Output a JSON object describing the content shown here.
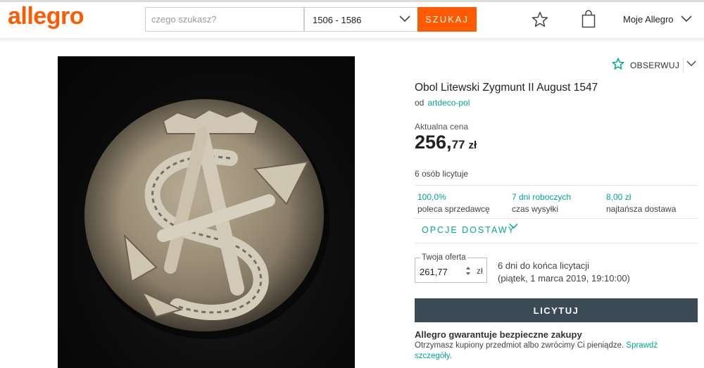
{
  "header": {
    "logo": "allegro",
    "search_placeholder": "czego szukasz?",
    "category_value": "1506 - 1586",
    "search_button": "SZUKAJ",
    "account_label": "Moje Allegro"
  },
  "listing": {
    "watch_label": "OBSERWUJ",
    "title": "Obol Litewski Zygmunt II August 1547",
    "seller_prefix": "od",
    "seller_name": "artdeco-pol",
    "price_label": "Aktualna cena",
    "price_main": "256,",
    "price_fraction": "77",
    "price_currency": "zł",
    "bidders": "6 osób licytuje",
    "stats": [
      {
        "value": "100,0%",
        "label": "poleca sprzedawcę"
      },
      {
        "value": "7 dni roboczych",
        "label": "czas wysyłki"
      },
      {
        "value": "8,00 zł",
        "label": "najtańsza dostawa"
      }
    ],
    "delivery_options": "OPCJE DOSTAWY",
    "bid_legend": "Twoja oferta",
    "bid_value": "261,77",
    "bid_currency": "zł",
    "time_left": "6 dni do końca licytacji",
    "end_date": "(piątek, 1 marca 2019, 19:10:00)",
    "bid_button": "LICYTUJ",
    "guarantee_title": "Allegro gwarantuje bezpieczne zakupy",
    "guarantee_text": "Otrzymasz kupiony przedmiot albo zwrócimy Ci pieniądze.",
    "guarantee_link": "Sprawdź szczegóły",
    "guarantee_end": "."
  },
  "colors": {
    "brand": "#ff5a00",
    "accent": "#00a790",
    "button_dark": "#3a4b55"
  }
}
